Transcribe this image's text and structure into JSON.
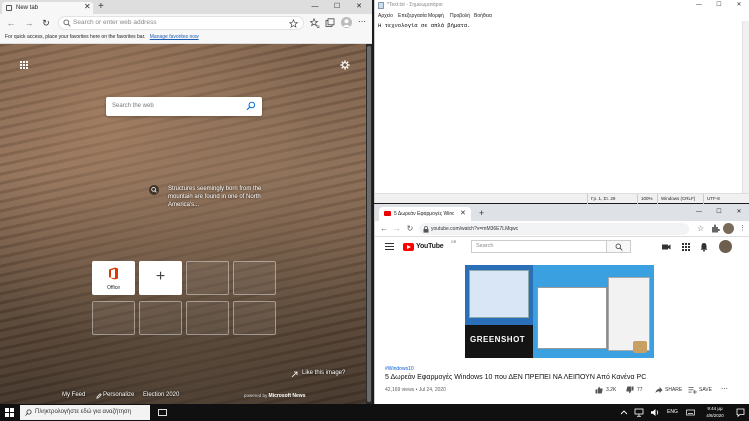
{
  "edge": {
    "tab_title": "New tab",
    "tab_close": "✕",
    "new_tab": "+",
    "win_min": "—",
    "win_max": "☐",
    "win_close": "✕",
    "address_placeholder": "Search or enter web address",
    "favbar_text": "For quick access, place your favorites here on the favorites bar.",
    "favbar_link": "Manage favorites now",
    "search_placeholder": "Search the web",
    "caption": "Structures seemingly born from the mountain are found in one of North America's...",
    "tiles": [
      {
        "label": "Office"
      },
      {
        "label": "+"
      }
    ],
    "like_text": "Like this image?",
    "bottom_links": [
      "My Feed",
      "Personalize",
      "Election 2020"
    ],
    "powered_by": "powered by",
    "powered_brand": "Microsoft News"
  },
  "notepad": {
    "title": "*Text.txt - Σημειωματάριο",
    "menus": [
      "Αρχείο",
      "Επεξεργασία",
      "Μορφή",
      "Προβολή",
      "Βοήθεια"
    ],
    "content": "Η τεχνολογία σε απλά βήματα.",
    "status": [
      "Γρ. 1, Στ. 29",
      "100%",
      "Windows (CRLF)",
      "UTF-8"
    ],
    "win_min": "—",
    "win_max": "☐",
    "win_close": "✕"
  },
  "chrome": {
    "tab_title": "5 Δωρεάν Εφαρμογές Wind",
    "tab_close": "✕",
    "new_tab": "+",
    "url": "youtube.com/watch?v=mM36E7LMqwc",
    "win_min": "—",
    "win_max": "☐",
    "win_close": "✕",
    "yt_brand": "YouTube",
    "yt_region": "GR",
    "search_placeholder": "Search",
    "thumb_label": "GREENSHOT",
    "hashtag": "#Windows10",
    "video_title": "5 Δωρεάν Εφαρμογές Windows 10 που ΔΕΝ ΠΡΕΠΕΙ ΝΑ ΛΕΙΠΟΥΝ Από Κανένα PC",
    "views": "42,169 views",
    "date": "Jul 24, 2020",
    "likes": "3.2K",
    "dislikes": "77",
    "share": "SHARE",
    "save": "SAVE"
  },
  "taskbar": {
    "search_placeholder": "Πληκτρολογήστε εδώ για αναζήτηση",
    "lang": "ENG",
    "time": "9:44 μμ",
    "date": "4/8/2020"
  },
  "colors": {
    "yt_red": "#ff0000",
    "link_blue": "#065fd4",
    "taskbar": "#101010"
  }
}
